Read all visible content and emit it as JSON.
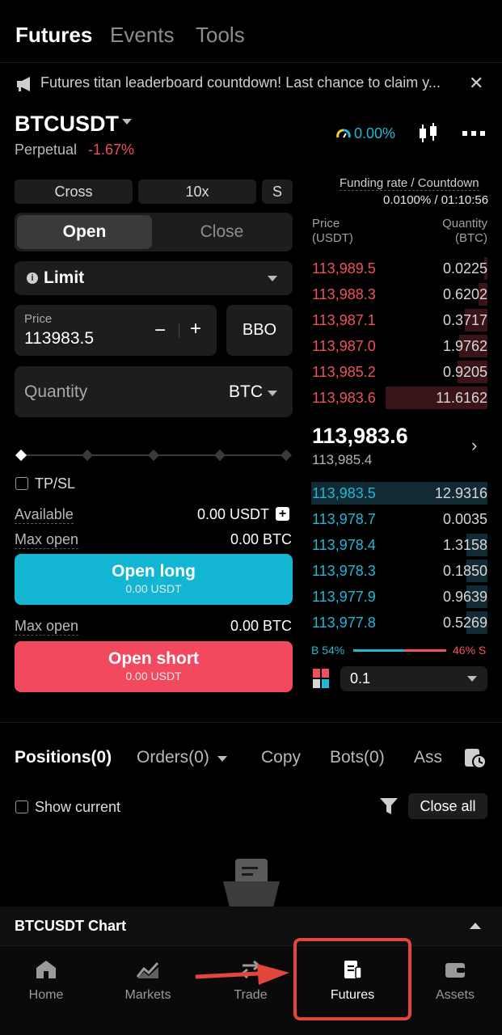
{
  "topnav": {
    "tabs": [
      "Futures",
      "Events",
      "Tools"
    ]
  },
  "announcement": {
    "text": "Futures titan leaderboard countdown! Last chance to claim y..."
  },
  "symbol": {
    "name": "BTCUSDT",
    "type": "Perpetual",
    "change": "-1.67%",
    "rate": "0.00%"
  },
  "form": {
    "margin_mode": "Cross",
    "leverage": "10x",
    "position_mode": "S",
    "open_tab": "Open",
    "close_tab": "Close",
    "order_type": "Limit",
    "price_label": "Price",
    "price_value": "113983.5",
    "minus": "−",
    "plus": "+",
    "bbo": "BBO",
    "qty_label": "Quantity",
    "qty_unit": "BTC",
    "tpsl": "TP/SL",
    "available_label": "Available",
    "available_value": "0.00 USDT",
    "max_open_label": "Max open",
    "max_open_long": "0.00 BTC",
    "max_open_short": "0.00 BTC",
    "open_long": "Open long",
    "open_long_sub": "0.00 USDT",
    "open_short": "Open short",
    "open_short_sub": "0.00 USDT",
    "slider_value_percent": 0
  },
  "orderbook": {
    "funding_label": "Funding rate / Countdown",
    "funding_value": "0.0100% / 01:10:56",
    "price_header": [
      "Price",
      "(USDT)"
    ],
    "qty_header": [
      "Quantity",
      "(BTC)"
    ],
    "asks": [
      {
        "price": "113,989.5",
        "qty": "0.0225",
        "depth": 0.02
      },
      {
        "price": "113,988.3",
        "qty": "0.6202",
        "depth": 0.05
      },
      {
        "price": "113,987.1",
        "qty": "0.3717",
        "depth": 0.13
      },
      {
        "price": "113,987.0",
        "qty": "1.9762",
        "depth": 0.16
      },
      {
        "price": "113,985.2",
        "qty": "0.9205",
        "depth": 0.17
      },
      {
        "price": "113,983.6",
        "qty": "11.6162",
        "depth": 0.58
      }
    ],
    "mid_price": "113,983.6",
    "mark_price": "113,985.4",
    "bids": [
      {
        "price": "113,983.5",
        "qty": "12.9316",
        "depth": 1.0
      },
      {
        "price": "113,978.7",
        "qty": "0.0035",
        "depth": 0.0
      },
      {
        "price": "113,978.4",
        "qty": "1.3158",
        "depth": 0.12
      },
      {
        "price": "113,978.3",
        "qty": "0.1850",
        "depth": 0.12
      },
      {
        "price": "113,977.9",
        "qty": "0.9639",
        "depth": 0.12
      },
      {
        "price": "113,977.8",
        "qty": "0.5269",
        "depth": 0.12
      }
    ],
    "buy_ratio": "B 54%",
    "sell_ratio": "46% S",
    "tick_size": "0.1"
  },
  "positions": {
    "tabs": [
      "Positions(0)",
      "Orders(0)",
      "Copy",
      "Bots(0)",
      "Ass"
    ],
    "show_current": "Show current",
    "close_all": "Close all"
  },
  "chart_bar": {
    "title": "BTCUSDT  Chart"
  },
  "bottom_nav": [
    "Home",
    "Markets",
    "Trade",
    "Futures",
    "Assets"
  ],
  "colors": {
    "long": "#13b6d2",
    "short": "#f2495e",
    "ask": "#f0505e",
    "bid": "#20b8d6",
    "highlight": "#e2463d"
  }
}
